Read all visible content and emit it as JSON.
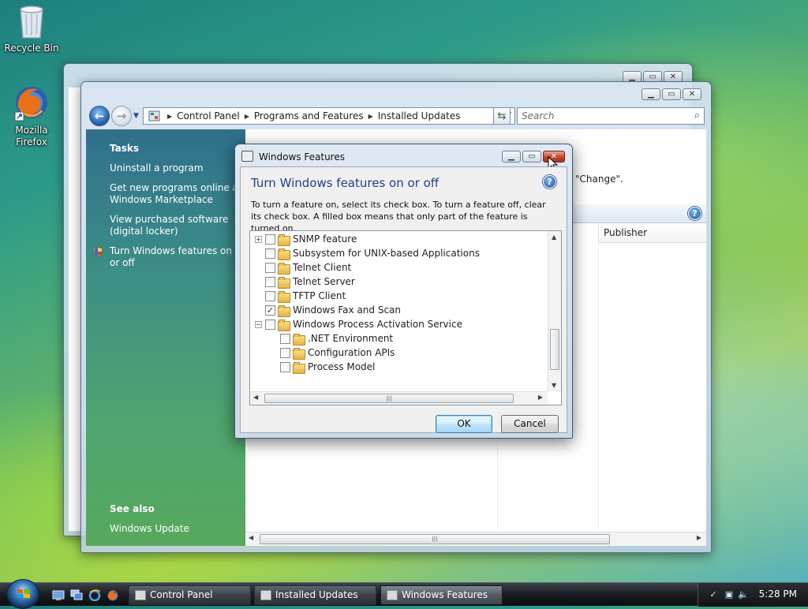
{
  "desktop": {
    "icons": [
      {
        "label": "Recycle Bin",
        "icon": "recycle-bin-icon"
      },
      {
        "label": "Mozilla Firefox",
        "icon": "firefox-icon"
      }
    ]
  },
  "main_window": {
    "address": {
      "crumbs": [
        "Control Panel",
        "Programs and Features",
        "Installed Updates"
      ]
    },
    "search": {
      "placeholder": "Search"
    },
    "tasks": {
      "header": "Tasks",
      "links": [
        "Uninstall a program",
        "Get new programs online at Windows Marketplace",
        "View purchased software (digital locker)",
        "Turn Windows features on or off"
      ],
      "see_also_header": "See also",
      "see_also_links": [
        "Windows Update"
      ]
    },
    "content": {
      "partial_text": "\"Change\".",
      "columns": [
        "Publisher"
      ]
    }
  },
  "dialog": {
    "title": "Windows Features",
    "heading": "Turn Windows features on or off",
    "description": "To turn a feature on, select its check box. To turn a feature off, clear its check box. A filled box means that only part of the feature is turned on.",
    "features": [
      {
        "label": "SNMP feature",
        "checked": false,
        "expander": "+",
        "level": 0
      },
      {
        "label": "Subsystem for UNIX-based Applications",
        "checked": false,
        "expander": "",
        "level": 0
      },
      {
        "label": "Telnet Client",
        "checked": false,
        "expander": "",
        "level": 0
      },
      {
        "label": "Telnet Server",
        "checked": false,
        "expander": "",
        "level": 0
      },
      {
        "label": "TFTP Client",
        "checked": false,
        "expander": "",
        "level": 0
      },
      {
        "label": "Windows Fax and Scan",
        "checked": true,
        "expander": "",
        "level": 0
      },
      {
        "label": "Windows Process Activation Service",
        "checked": false,
        "expander": "−",
        "level": 0
      },
      {
        "label": ".NET Environment",
        "checked": false,
        "expander": "",
        "level": 1
      },
      {
        "label": "Configuration APIs",
        "checked": false,
        "expander": "",
        "level": 1
      },
      {
        "label": "Process Model",
        "checked": false,
        "expander": "",
        "level": 1
      }
    ],
    "ok_label": "OK",
    "cancel_label": "Cancel"
  },
  "taskbar": {
    "buttons": [
      {
        "label": "Control Panel",
        "active": false
      },
      {
        "label": "Installed Updates",
        "active": false
      },
      {
        "label": "Windows Features",
        "active": true
      }
    ],
    "clock": "5:28 PM"
  },
  "colors": {
    "dialog_heading": "#1e3f8c",
    "task_pane_top": "#2f6f8d",
    "task_pane_bottom": "#57a85d"
  }
}
